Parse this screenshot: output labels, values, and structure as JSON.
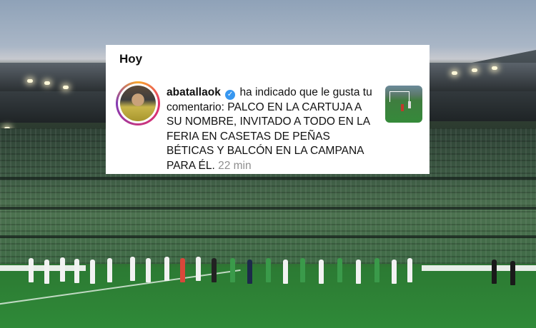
{
  "notification": {
    "section_label": "Hoy",
    "username": "abatallaok",
    "verified": true,
    "message": "ha indicado que le gusta tu comentario: PALCO EN LA CARTUJA A SU NOMBRE, INVITADO A TODO EN LA FERIA EN CASETAS DE PEÑAS BÉTICAS Y BALCÓN EN LA CAMPANA PARA ÉL.",
    "time": "22 min",
    "icons": {
      "verified": "verified-badge-icon"
    }
  },
  "colors": {
    "verified_blue": "#3797f0",
    "story_ring": [
      "#f9a72b",
      "#e1306c",
      "#c13584",
      "#833ab4"
    ],
    "time_gray": "#8e8e8e"
  }
}
